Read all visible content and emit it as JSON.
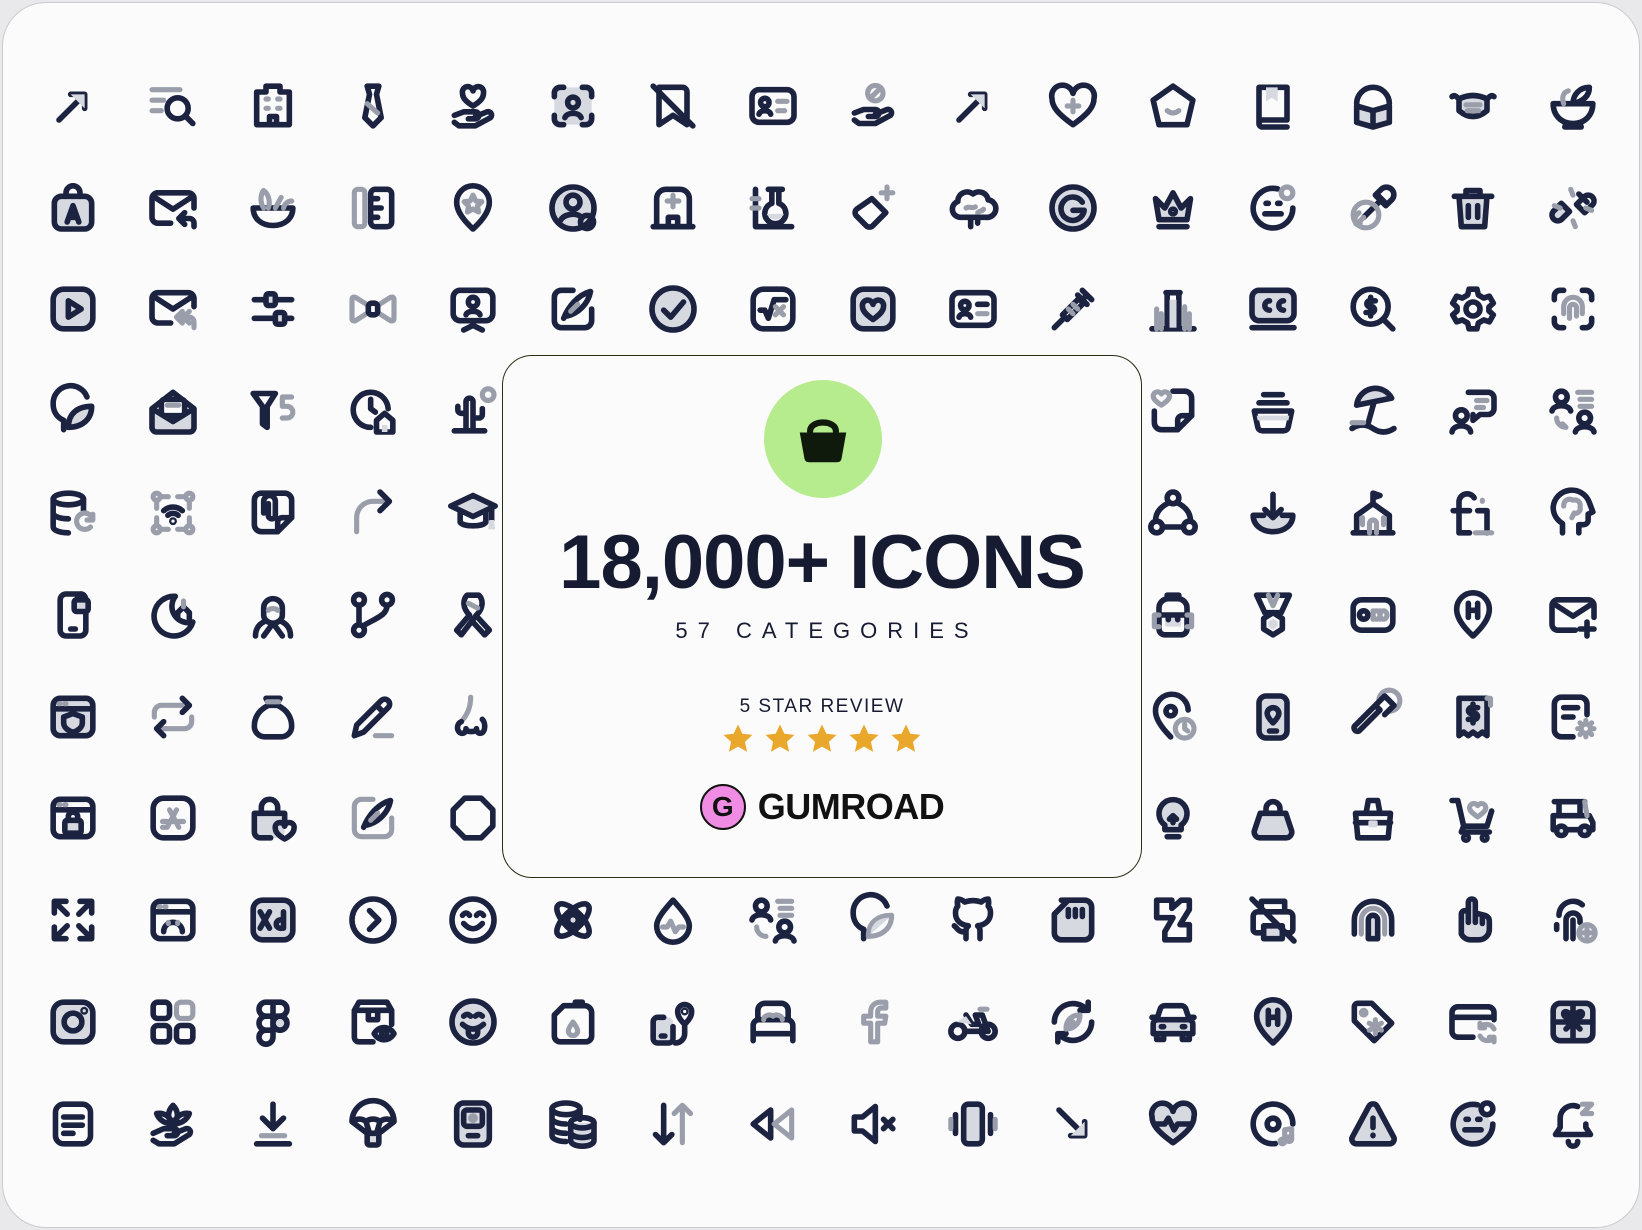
{
  "headline": "18,000+ ICONS",
  "subheadline": "57 CATEGORIES",
  "review": {
    "label": "5 STAR REVIEW",
    "stars": 5,
    "star_color": "#e9a72b"
  },
  "brand": {
    "badge_letter": "G",
    "name": "GUMROAD",
    "badge_color": "#f08ce4"
  },
  "logo": {
    "icon": "basket-icon",
    "background": "#b6ec8e"
  },
  "colors": {
    "stroke": "#1c2340",
    "secondary": "#9a9eab",
    "fill": "#d7d9e1",
    "card_border": "#273014"
  },
  "grid": {
    "columns": 16,
    "rows": [
      [
        "arrow-up-left-icon",
        "list-search-icon",
        "office-building-icon",
        "necktie-icon",
        "hand-heart-icon",
        "face-scan-icon",
        "bookmark-off-icon",
        "id-card-icon",
        "hand-ban-icon",
        "arrow-up-right-icon",
        "heart-plus-icon",
        "pentagon-icon",
        "book-icon",
        "head-reading-icon",
        "face-mask-icon",
        "mortar-pestle-icon"
      ],
      [
        "bag-a-icon",
        "mail-reply-icon",
        "salad-bowl-icon",
        "ruler-pencil-icon",
        "location-star-icon",
        "user-circle-icon",
        "hospital-icon",
        "test-tube-icon",
        "eraser-plus-icon",
        "brain-cloud-icon",
        "g-circle-icon",
        "crown-icon",
        "face-neutral-icon",
        "pipette-icon",
        "trash-icon",
        "plug-disconnect-icon"
      ],
      [
        "play-square-icon",
        "mail-multiple-icon",
        "sliders-icon",
        "bow-tie-icon",
        "presentation-user-icon",
        "edit-feather-icon",
        "check-circle-icon",
        "sqrt-icon",
        "heart-square-icon",
        "id-card-alt-icon",
        "syringe-icon",
        "city-chart-icon",
        "cc-badge-icon",
        "dollar-search-icon",
        "settings-gear-icon",
        "scan-fingerprint-icon"
      ],
      [
        "leaf-head-icon",
        "mail-open-icon",
        "filter-five-icon",
        "clock-home-icon",
        "cactus-icon",
        "",
        "",
        "",
        "",
        "",
        "",
        "heart-note-icon",
        "bowl-stack-icon",
        "beach-umbrella-icon",
        "chat-user-icon",
        "user-swap-icon"
      ],
      [
        "database-refresh-icon",
        "wifi-nodes-icon",
        "paperclip-note-icon",
        "arrow-curve-right-icon",
        "graduation-cap-icon",
        "",
        "",
        "",
        "",
        "",
        "",
        "network-triangle-icon",
        "download-bowl-icon",
        "school-flag-icon",
        "fi-letters-icon",
        "head-brain-icon"
      ],
      [
        "phone-lock-icon",
        "moon-mosque-icon",
        "person-hood-icon",
        "git-branch-icon",
        "awareness-ribbon-icon",
        "",
        "",
        "",
        "",
        "",
        "",
        "backpack-icon",
        "medal-icon",
        "ooo-badge-icon",
        "location-h-icon",
        "mail-plus-icon"
      ],
      [
        "browser-shield-icon",
        "repeat-arrows-icon",
        "money-bag-icon",
        "pencil-line-icon",
        "nose-icon",
        "",
        "",
        "",
        "",
        "",
        "",
        "location-time-icon",
        "phone-location-icon",
        "brush-stroke-icon",
        "receipt-dollar-icon",
        "document-settings-icon"
      ],
      [
        "browser-lock-icon",
        "app-store-icon",
        "lock-heart-icon",
        "feather-square-icon",
        "octagon-icon",
        "",
        "",
        "",
        "",
        "",
        "",
        "light-bulb-icon",
        "handbag-icon",
        "shopping-bag-icon",
        "cart-heart-icon",
        "golf-cart-icon"
      ],
      [
        "expand-arrows-icon",
        "browser-sad-icon",
        "xd-app-icon",
        "chevron-right-circle-icon",
        "smile-happy-icon",
        "atom-icon",
        "drop-pulse-icon",
        "user-list-icon",
        "leaf-heart-icon",
        "github-icon",
        "memory-card-icon",
        "deviantart-icon",
        "printer-off-icon",
        "fingerprint-arch-icon",
        "hand-pointing-icon",
        "fingerprint-plus-icon"
      ],
      [
        "instagram-icon",
        "grid-apps-icon",
        "figma-icon",
        "package-eye-icon",
        "smile-tongue-icon",
        "jerrycan-icon",
        "phone-location-pin-icon",
        "bed-icon",
        "facebook-icon",
        "motorcycle-icon",
        "eco-refresh-icon",
        "car-front-icon",
        "location-h-alt-icon",
        "tag-star-icon",
        "card-refresh-icon",
        "gift-box-icon"
      ],
      [
        "document-lines-icon",
        "lotus-hand-icon",
        "download-tray-icon",
        "parachute-icon",
        "phone-device-icon",
        "coins-stack-icon",
        "sort-arrows-icon",
        "rewind-icon",
        "volume-mute-icon",
        "vibrate-phone-icon",
        "arrow-down-right-icon",
        "heart-pulse-icon",
        "disc-music-icon",
        "warning-triangle-icon",
        "face-dash-icon",
        "bell-sleep-icon"
      ]
    ]
  }
}
